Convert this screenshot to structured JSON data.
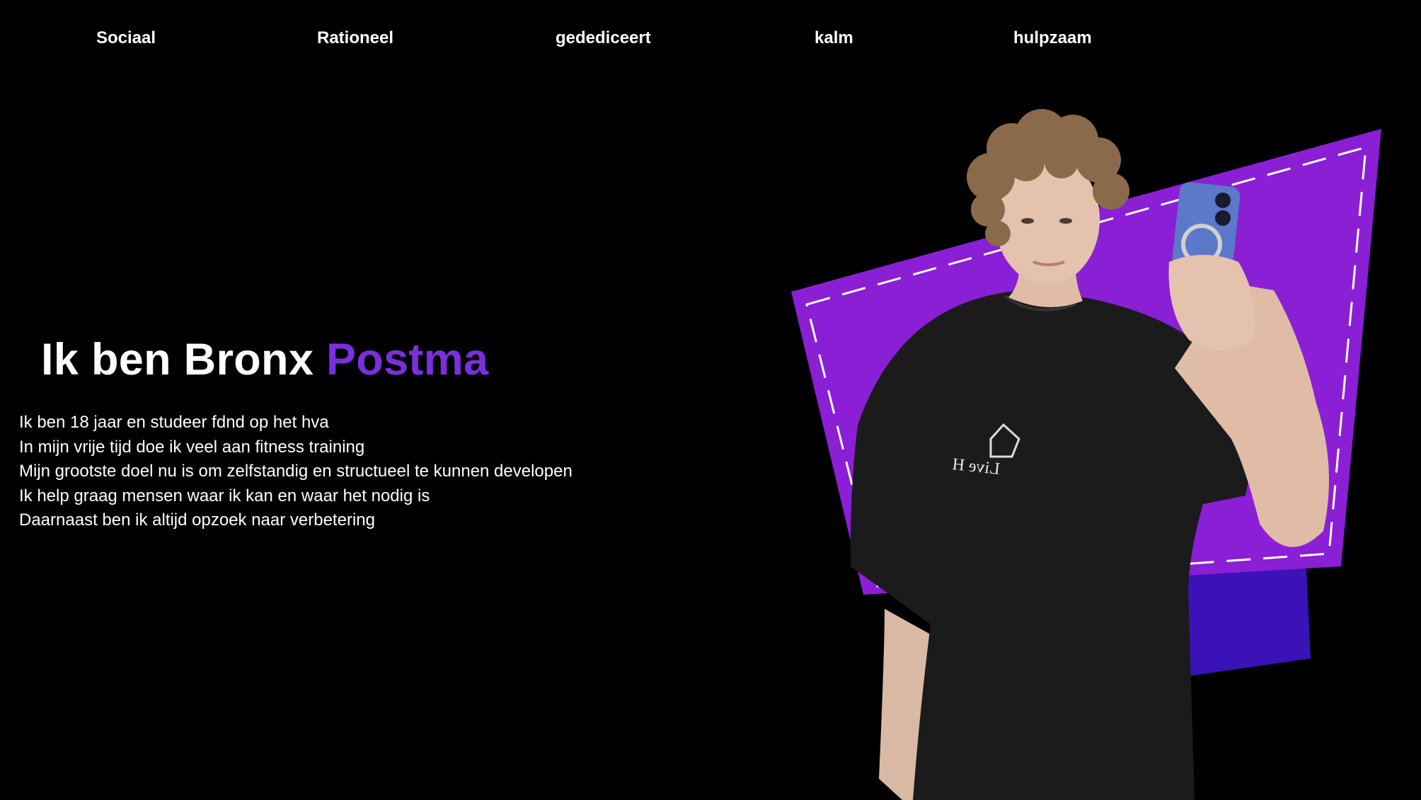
{
  "nav": {
    "items": [
      {
        "label": "Sociaal"
      },
      {
        "label": "Rationeel"
      },
      {
        "label": "gedediceert"
      },
      {
        "label": "kalm"
      },
      {
        "label": "hulpzaam"
      }
    ]
  },
  "hero": {
    "title_prefix": "Ik ben Bronx",
    "title_accent": "Postma",
    "lines": [
      "Ik ben 18 jaar en studeer fdnd op het hva",
      "In mijn vrije tijd doe ik veel aan fitness training",
      "Mijn grootste doel nu is om zelfstandig en structueel te kunnen developen",
      "Ik help graag mensen waar ik kan en waar het nodig is",
      "Daarnaast ben ik altijd opzoek naar verbetering"
    ]
  },
  "photo": {
    "shirt_print": "Live H"
  },
  "colors": {
    "background": "#000000",
    "accent": "#7a2fdc",
    "shape_purple": "#8a1fd6",
    "shape_blue": "#3a12b8"
  }
}
